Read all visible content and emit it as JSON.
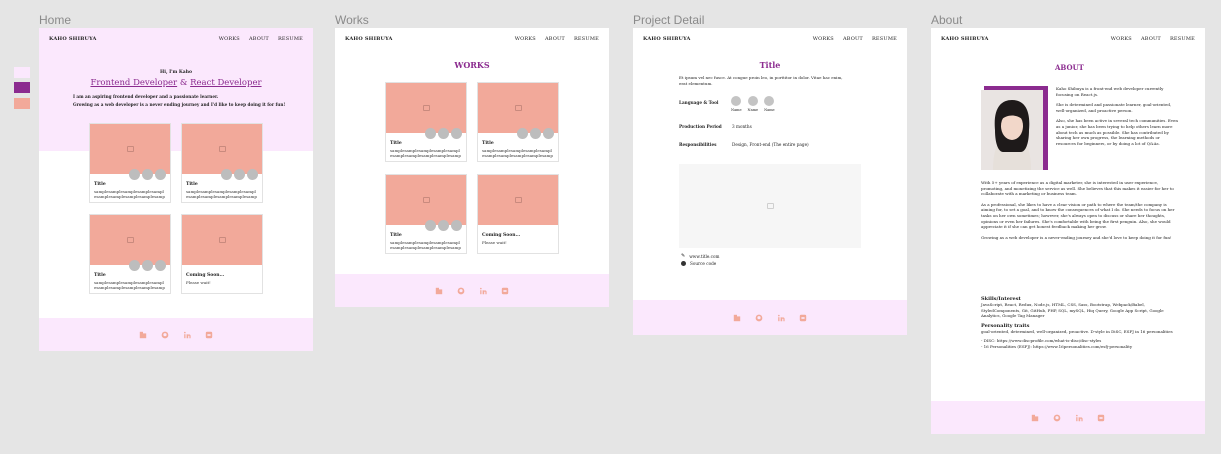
{
  "nav": {
    "brand": "KAHO SHIBUYA",
    "works": "WORKS",
    "about": "ABOUT",
    "resume": "RESUME"
  },
  "colors": {
    "light_pink": "#fbe8fd",
    "purple": "#8b2b8f",
    "salmon": "#f2a99a"
  },
  "frames": {
    "home": "Home",
    "works": "Works",
    "project_detail": "Project Detail",
    "about": "About"
  },
  "footer_icons": [
    "blog-icon",
    "github-icon",
    "linkedin-icon",
    "wantedly-icon"
  ],
  "home": {
    "greeting": "Hi, I'm Kaho",
    "role_a": "Frontend Developer",
    "amp": " & ",
    "role_b": "React Developer",
    "intro1": "I am an aspiring frontend developer and a passionate learner.",
    "intro2": "Growing as a web developer is a never ending journey and I'd like to keep doing it for fun!"
  },
  "card_title": "Title",
  "card_desc": "samplesamplesamplesamplesamplesamplesamplesamplesamplesamplesample",
  "coming_title": "Coming Soon...",
  "coming_desc": "Please wait!",
  "works": {
    "title": "WORKS"
  },
  "detail": {
    "title": "Title",
    "desc": "Et ipsum vel nec fusce. At congue proin leo, in porttitor in dolor. Vitae hac enim, erat elementum.",
    "lang_label": "Language & Tool",
    "tools": [
      "Name",
      "Name",
      "Name"
    ],
    "period_label": "Production Period",
    "period_value": "3 months",
    "resp_label": "Responsibilities",
    "resp_value": "Design, Front-end (The entire page)",
    "link_site": "www.title.com",
    "link_source": "Source code"
  },
  "about": {
    "title": "ABOUT",
    "p1": "Kaho Shibuya is a front-end web developer currently focusing on React.js.",
    "p2": "She is determined and passionate learner, goal-oriented, well-organized, and proactive person.",
    "p3": "Also, she has been active in several tech communities. Even as a junior, she has been trying to help others learn more about tech as much as possible. She has contributed by sharing her own progress, the learning methods or resources for beginners, or by doing a lot of Q&As.",
    "p4": "With 5+ years of experience as a digital marketer, she is interested in user experience, promoting, and monetizing the service as well. She believes that this makes it easier for her to collaborate with a marketing or business team.",
    "p5": "As a professional, she likes to have a clear vision or path to where the team/the company is aiming for, to set a goal, and to know the consequences of what I do. She needs to focus on her tasks on her own sometimes; however, she's always open to discuss or share her thoughts, opinions or even her failures. She's comfortable with being the first penguin. Also, she would appreciate it if she can get honest feedback making her grow.",
    "p6": "Growing as a web developer is a never-ending journey and she'd love to keep doing it for fun!",
    "skills_title": "Skills/Interest",
    "skills": "JavaScript, React, Redux, Node.js, HTML, CSS, Sass, Bootstrap, Webpack/Babel, StyledComponents, Git, GitHub, PHP, SQL, mySQL, Hiq Query, Google App Script, Google Analytics, Google Tag Manager",
    "traits_title": "Personality traits",
    "traits": "goal-oriented, determined, well-organized, proactive. D-style in DiSC, ESFJ in 16 personalities",
    "link1": "- DISC: https://www.discprofile.com/what-is-disc/disc-styles",
    "link2": "- 16 Personalities (ESFJ): https://www.16personalities.com/esfj-personality"
  }
}
